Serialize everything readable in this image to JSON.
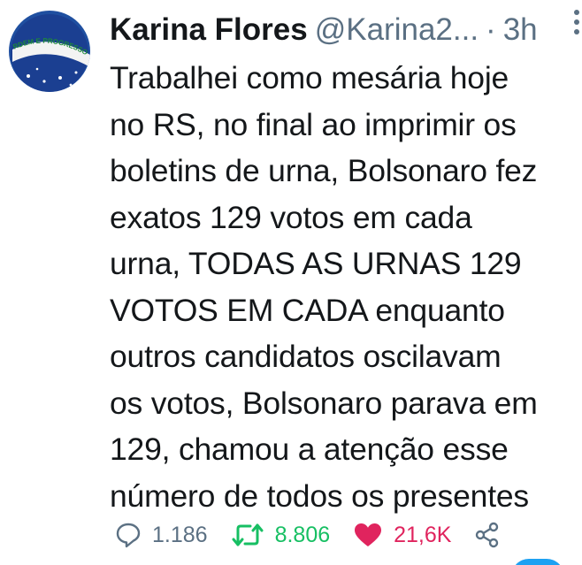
{
  "tweet": {
    "author_name": "Karina Flores",
    "handle": "@Karina2...",
    "separator": "·",
    "time": "3h",
    "avatar_text": "RDEM E PROGRESSO",
    "text": "Trabalhei como mesária hoje\nno RS, no final ao imprimir os\nboletins de urna, Bolsonaro fez\nexatos 129 votos em cada\nurna, TODAS AS URNAS 129\nVOTOS EM CADA enquanto\noutros candidatos oscilavam\nos votos, Bolsonaro parava em\n129, chamou a atenção esse\nnúmero de todos os presentes"
  },
  "actions": {
    "reply_count": "1.186",
    "retweet_count": "8.806",
    "like_count": "21,6K"
  },
  "colors": {
    "text": "#14171a",
    "muted": "#5b7083",
    "retweet": "#17bf63",
    "like": "#e0245e",
    "brand_blue": "#1da1f2"
  },
  "icons": {
    "more": "more-vertical-icon",
    "reply": "reply-icon",
    "retweet": "retweet-icon",
    "like": "heart-icon",
    "share": "share-icon"
  }
}
